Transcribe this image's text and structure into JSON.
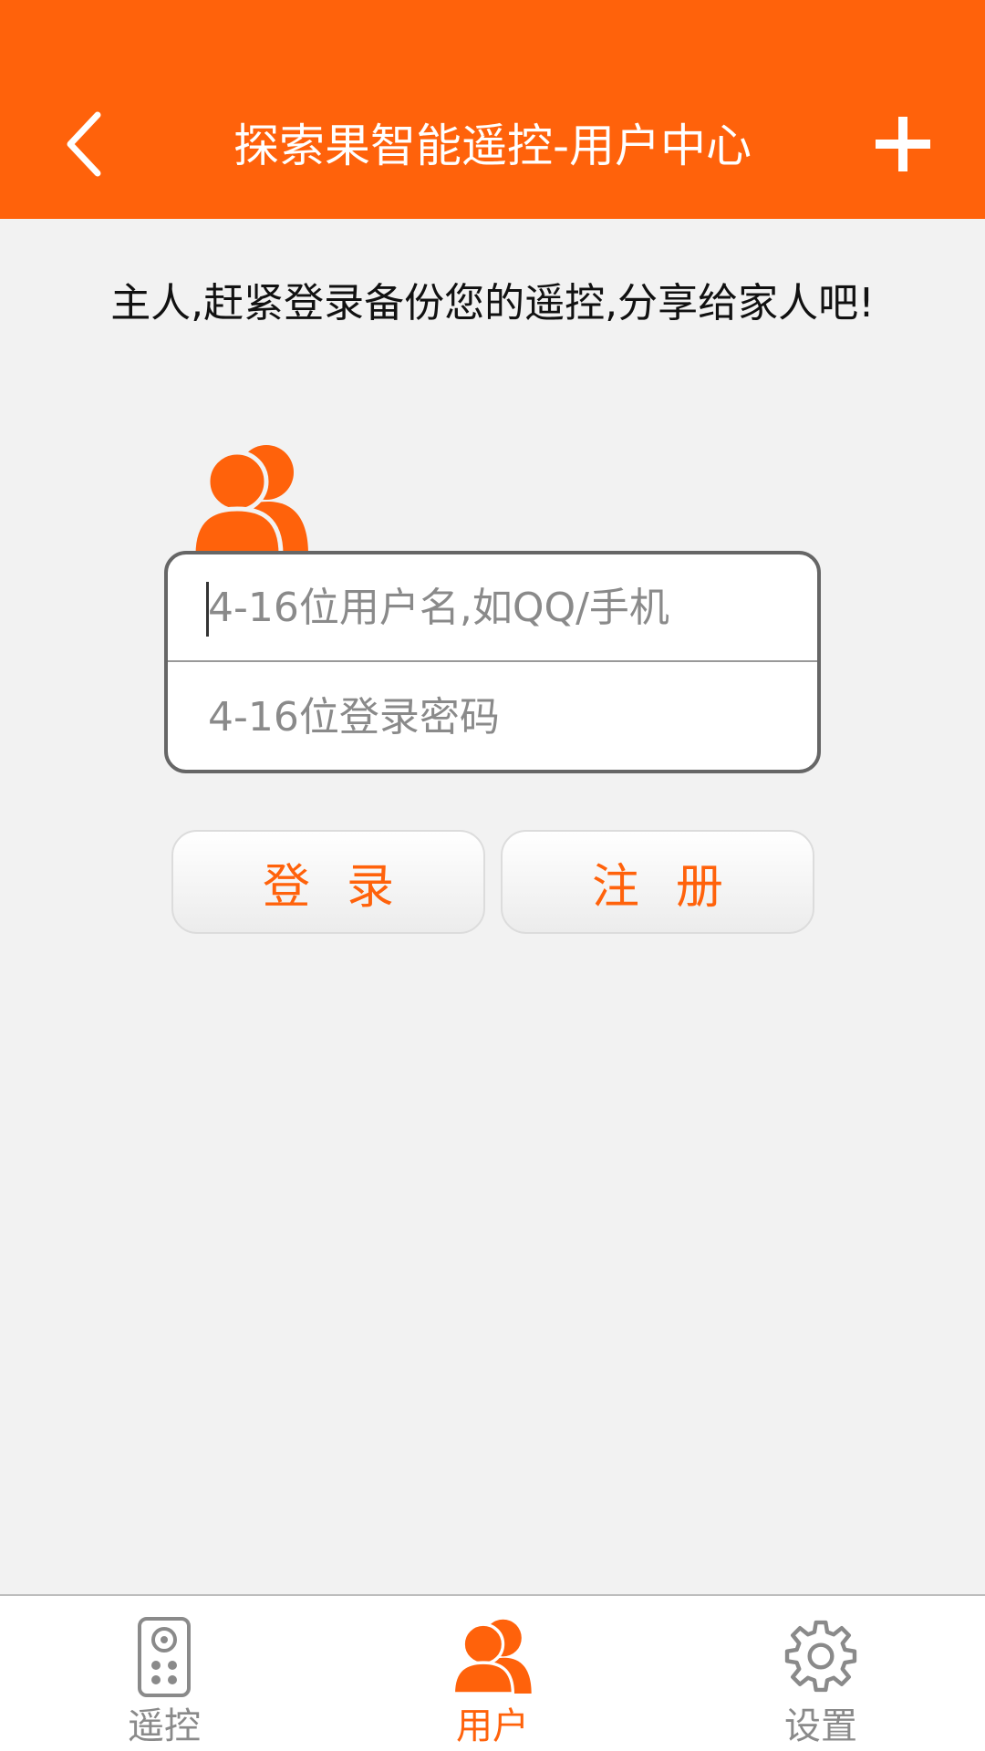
{
  "header": {
    "title": "探索果智能遥控-用户中心",
    "back_icon": "chevron-left-icon",
    "add_icon": "plus-icon",
    "background_color": "#ff620b"
  },
  "prompt": "主人,赶紧登录备份您的遥控,分享给家人吧!",
  "form": {
    "username_placeholder": "4-16位用户名,如QQ/手机",
    "password_placeholder": "4-16位登录密码",
    "user_icon": "users-icon"
  },
  "buttons": {
    "login_label": "登录",
    "register_label": "注册"
  },
  "tabbar": {
    "active_index": 1,
    "active_color": "#ff620b",
    "inactive_color": "#8a8a8a",
    "tabs": [
      {
        "label": "遥控",
        "icon": "remote-control-icon"
      },
      {
        "label": "用户",
        "icon": "users-icon"
      },
      {
        "label": "设置",
        "icon": "gear-icon"
      }
    ]
  }
}
